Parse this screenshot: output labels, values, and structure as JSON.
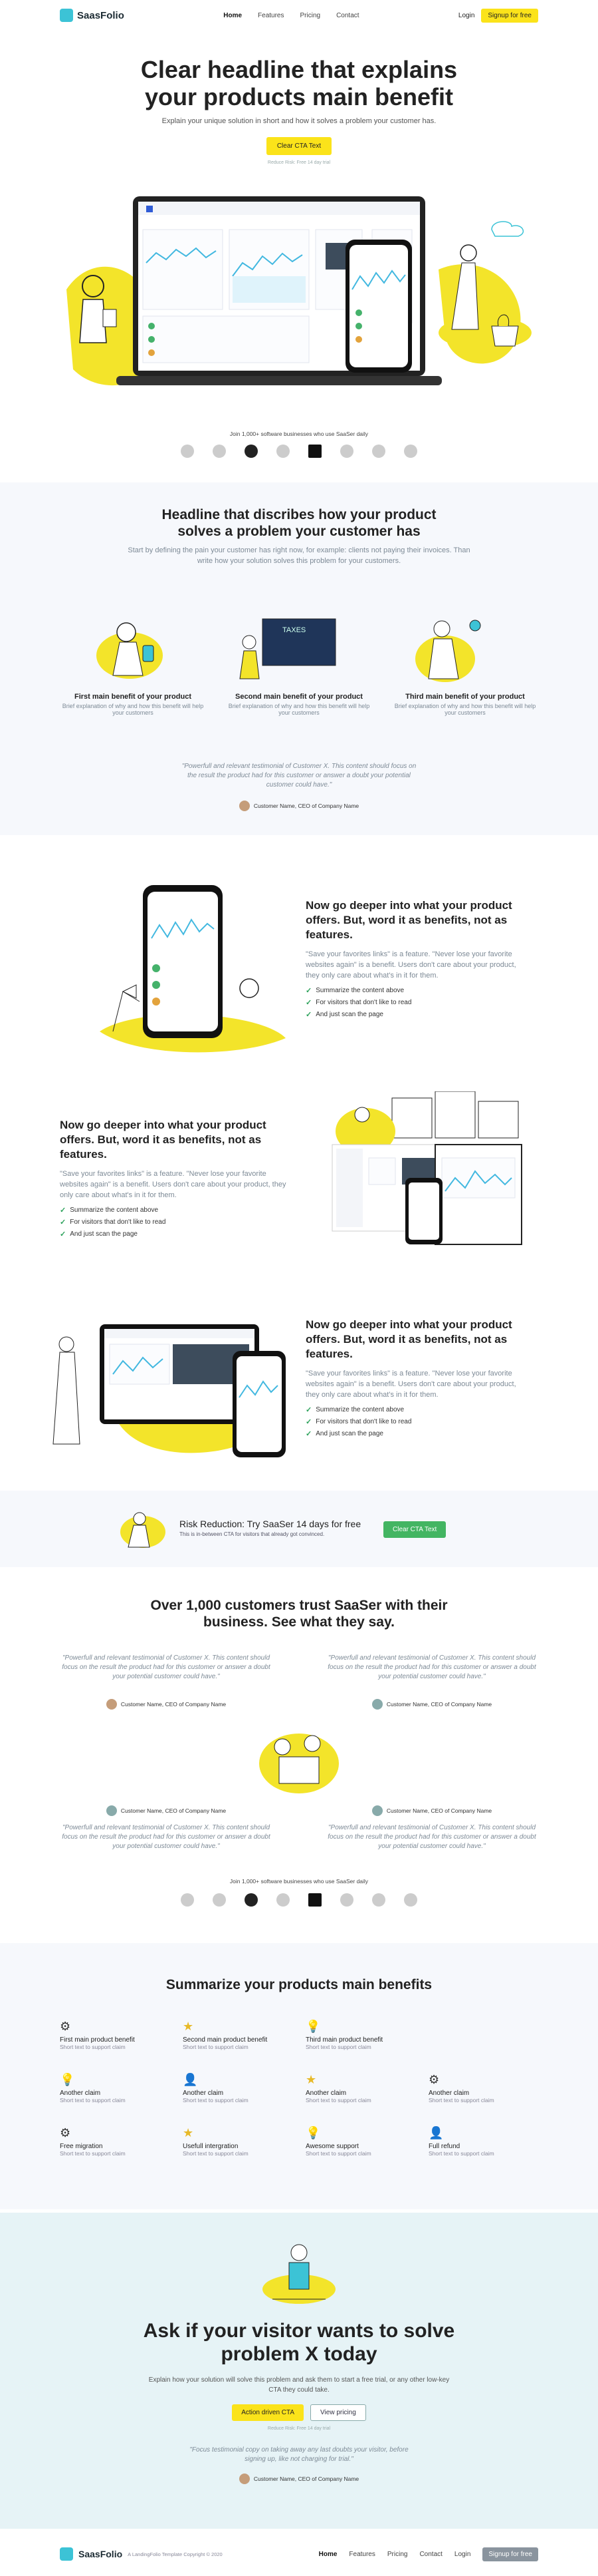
{
  "nav": {
    "brand": "SaasFolio",
    "links": [
      "Home",
      "Features",
      "Pricing",
      "Contact"
    ],
    "login": "Login",
    "signup": "Signup for free"
  },
  "hero": {
    "title_line1": "Clear headline that explains",
    "title_line2": "your products main benefit",
    "subtitle": "Explain your unique solution in short and how it solves a problem your customer has.",
    "cta": "Clear CTA Text",
    "note": "Reduce Risk: Free 14 day trial",
    "logos_title": "Join 1,000+ software businesses who use SaaSer daily"
  },
  "benefits": {
    "title_line1": "Headline that discribes how your product",
    "title_line2": "solves a problem your customer has",
    "subtitle": "Start by defining the pain your customer has right now, for example: clients not paying their invoices. Than write how your solution solves this problem for your customers.",
    "items": [
      {
        "title": "First main benefit of your product",
        "text": "Brief explanation of why and how this benefit will help your customers"
      },
      {
        "title": "Second main benefit of your product",
        "text": "Brief explanation of why and how this benefit will help your customers"
      },
      {
        "title": "Third main benefit of your product",
        "text": "Brief explanation of why and how this benefit will help your customers"
      }
    ],
    "board_text": "TAXES",
    "testimonial": "\"Powerfull and relevant testimonial of Customer X. This content should focus on the result the product had for this customer or answer a doubt your potential customer could have.\"",
    "author": "Customer Name, CEO of Company Name"
  },
  "features": [
    {
      "title": "Now go deeper into what your product offers. But, word it as benefits, not as features.",
      "text": "\"Save your favorites links\" is a feature. \"Never lose your favorite websites again\" is a benefit. Users don't care about your product, they only care about what's in it for them.",
      "checks": [
        "Summarize the content above",
        "For visitors that don't like to read",
        "And just scan the page"
      ]
    },
    {
      "title": "Now go deeper into what your product offers. But, word it as benefits, not as features.",
      "text": "\"Save your favorites links\" is a feature. \"Never lose your favorite websites again\" is a benefit. Users don't care about your product, they only care about what's in it for them.",
      "checks": [
        "Summarize the content above",
        "For visitors that don't like to read",
        "And just scan the page"
      ]
    },
    {
      "title": "Now go deeper into what your product offers. But, word it as benefits, not as features.",
      "text": "\"Save your favorites links\" is a feature. \"Never lose your favorite websites again\" is a benefit. Users don't care about your product, they only care about what's in it for them.",
      "checks": [
        "Summarize the content above",
        "For visitors that don't like to read",
        "And just scan the page"
      ]
    }
  ],
  "risk": {
    "title": "Risk Reduction: Try SaaSer 14 days for free",
    "text": "This is in-between CTA for visitors that already got convinced.",
    "button": "Clear CTA Text"
  },
  "trust": {
    "title_line1": "Over 1,000 customers trust SaaSer with their",
    "title_line2": "business. See what they say.",
    "quote": "\"Powerfull and relevant testimonial of Customer X. This content should focus on the result the product had for this customer or answer a doubt your potential customer could have.\"",
    "author": "Customer Name, CEO of Company Name",
    "logos_title": "Join 1,000+ software businesses who use SaaSer daily"
  },
  "summary": {
    "title": "Summarize your products main benefits",
    "items": [
      {
        "title": "First main product benefit",
        "text": "Short text to support claim",
        "icon": "gear-icon"
      },
      {
        "title": "Second main product benefit",
        "text": "Short text to support claim",
        "icon": "star-icon"
      },
      {
        "title": "Third main product benefit",
        "text": "Short text to support claim",
        "icon": "bulb-icon"
      },
      {
        "title": "Another claim",
        "text": "Short text to support claim",
        "icon": "bulb-icon"
      },
      {
        "title": "Another claim",
        "text": "Short text to support claim",
        "icon": "person-icon"
      },
      {
        "title": "Another claim",
        "text": "Short text to support claim",
        "icon": "star-icon"
      },
      {
        "title": "Another claim",
        "text": "Short text to support claim",
        "icon": "gear-icon"
      },
      {
        "title": "Free migration",
        "text": "Short text to support claim",
        "icon": "gear-icon"
      },
      {
        "title": "Usefull intergration",
        "text": "Short text to support claim",
        "icon": "star-icon"
      },
      {
        "title": "Awesome support",
        "text": "Short text to support claim",
        "icon": "bulb-icon"
      },
      {
        "title": "Full refund",
        "text": "Short text to support claim",
        "icon": "person-icon"
      }
    ]
  },
  "cta": {
    "title_line1": "Ask if your visitor wants to solve",
    "title_line2": "problem X today",
    "text": "Explain how your solution will solve this problem and ask them to start a free trial, or any other low-key CTA they could take.",
    "primary": "Action driven CTA",
    "secondary": "View pricing",
    "note": "Reduce Risk: Free 14 day trial",
    "quote": "\"Focus testimonial copy on taking away any last doubts your visitor, before signing up, like not charging for trial.\"",
    "author": "Customer Name, CEO of Company Name"
  },
  "footer": {
    "brand": "SaasFolio",
    "copyright": "A LandingFolio Template Copyright © 2020",
    "links": [
      "Home",
      "Features",
      "Pricing",
      "Contact"
    ],
    "login": "Login",
    "signup": "Signup for free"
  }
}
